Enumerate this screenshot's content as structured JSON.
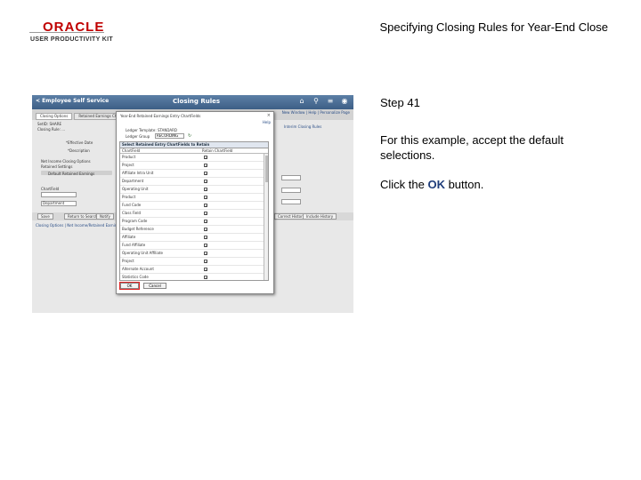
{
  "logo": {
    "brand": "ORACLE",
    "subtitle": "USER PRODUCTIVITY KIT"
  },
  "slide_title": "Specifying Closing Rules for Year-End Close",
  "screenshot": {
    "header": {
      "back": "< Employee Self Service",
      "title": "Closing Rules"
    },
    "top_links": "New Window | Help | Personalize Page",
    "tabs": [
      "Closing Options",
      "Retained Earnings Ch...",
      "Closing Trees"
    ],
    "background": {
      "setid_label": "SetID: SHARE",
      "closing_rule_label": "Closing Rule: ...",
      "effective_date_label": "*Effective Date",
      "description_label": "*Description",
      "net_income_label": "Net Income Closing Options",
      "retained_settings_label": "Retained Settings",
      "default_chartfields_label": "Default Retained Earnings",
      "chartfield_label": "ChartField",
      "department_value": "Department",
      "right_link": "Interim Closing Rules",
      "bottom_link": "Closing Options | Net Income/Retained Earnings | Closing Trees",
      "buttons": [
        "Save",
        "Return to Search",
        "Notify",
        "Refresh",
        "Add",
        "Update/Display",
        "Include History",
        "Correct History"
      ]
    },
    "modal": {
      "title": "Year-End Retained Earnings Entry ChartFields",
      "close": "×",
      "help": "Help",
      "ledger_template": "Ledger Template: STANDARD",
      "ledger_group_label": "Ledger Group",
      "ledger_group_value": "RECORDING",
      "grid_caption": "Select Retained Entry ChartFields to Retain",
      "col_chartfield": "ChartField",
      "col_retain": "Retain ChartField",
      "rows": [
        "Product",
        "Project",
        "Affiliate Intra Unit",
        "Department",
        "Operating Unit",
        "Product",
        "Fund Code",
        "Class Field",
        "Program Code",
        "Budget Reference",
        "Affiliate",
        "Fund Affiliate",
        "Operating Unit Affiliate",
        "Project",
        "Alternate Account",
        "Statistics Code"
      ],
      "ok": "OK",
      "cancel": "Cancel"
    }
  },
  "step": "Step 41",
  "instruction": "For this example, accept the default selections.",
  "click": {
    "prefix": "Click the ",
    "bold": "OK",
    "suffix": " button."
  }
}
